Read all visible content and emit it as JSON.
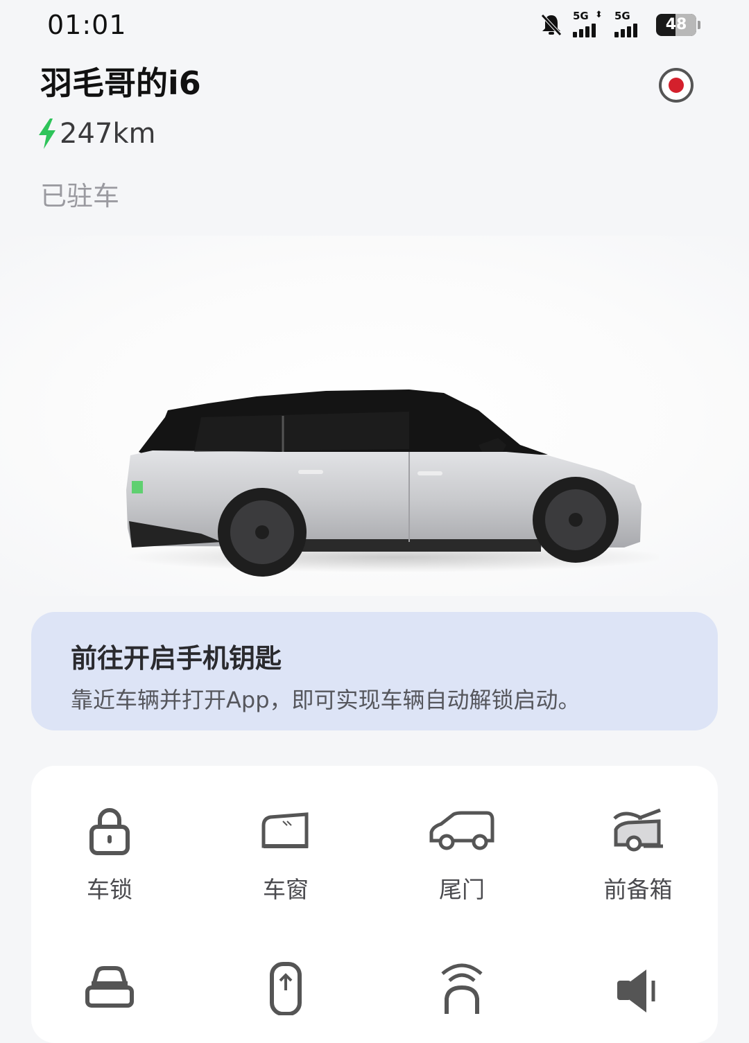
{
  "status_bar": {
    "time": "01:01",
    "network1": "5G",
    "network2": "5G",
    "battery": "48",
    "battery_level": 0.48
  },
  "vehicle": {
    "name": "羽毛哥的i6",
    "range": "247km",
    "status": "已驻车"
  },
  "key_banner": {
    "title": "前往开启手机钥匙",
    "description": "靠近车辆并打开App，即可实现车辆自动解锁启动。"
  },
  "controls": [
    {
      "label": "车锁",
      "icon": "lock-icon"
    },
    {
      "label": "车窗",
      "icon": "window-icon"
    },
    {
      "label": "尾门",
      "icon": "tailgate-icon"
    },
    {
      "label": "前备箱",
      "icon": "frunk-icon"
    },
    {
      "label": "",
      "icon": "car-front-icon"
    },
    {
      "label": "",
      "icon": "car-top-icon"
    },
    {
      "label": "",
      "icon": "car-signal-icon"
    },
    {
      "label": "",
      "icon": "horn-icon"
    }
  ],
  "colors": {
    "background": "#f5f6f8",
    "accent_green": "#2ec45a",
    "record_red": "#d4202c",
    "banner": "#dde4f6"
  }
}
